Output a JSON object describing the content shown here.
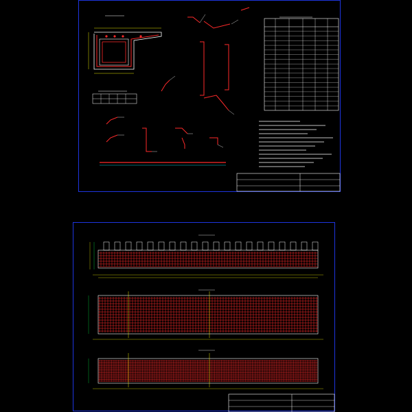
{
  "sheets": [
    {
      "title_block": {
        "project_line1": "",
        "project_line2": "",
        "project_line3": "",
        "right_line1": "",
        "right_line2": "",
        "right_line3": ""
      }
    },
    {
      "title_block": {
        "project_line1": "",
        "project_line2": "",
        "project_line3": "",
        "right_line1": "",
        "right_line2": "",
        "right_line3": ""
      }
    }
  ],
  "top_sheet": {
    "section_title": "",
    "table_title": "",
    "table_rows": 18,
    "note_lines": 12,
    "detail_title": ""
  },
  "bottom_sheet": {
    "view1_title": "",
    "view2_title": "",
    "view3_title": ""
  },
  "colors": {
    "border": "#1e35e0",
    "rebar": "#ff2a2a",
    "dimension": "#e8e800",
    "outline": "#ffffff",
    "dim_green": "#00e040",
    "cyan": "#00d0e0"
  }
}
